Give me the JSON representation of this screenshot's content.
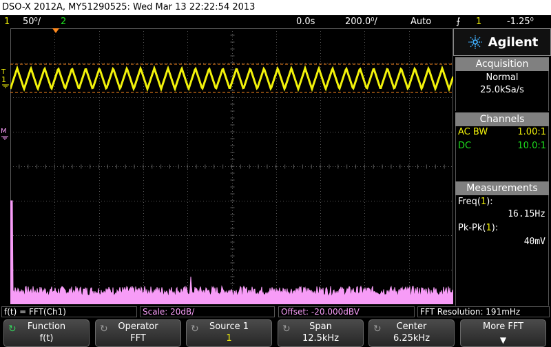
{
  "title_bar": {
    "text": "DSO-X 2012A, MY51290525: Wed Mar 13 22:22:54 2013"
  },
  "status_bar": {
    "ch1_num": "1",
    "ch1_scale": "50⁰/",
    "ch2_num": "2",
    "time_pos": "0.0s",
    "time_scale": "200.0⁰/",
    "trig_mode": "Auto",
    "trig_icon": "⨍",
    "trig_src": "1",
    "trig_level": "-1.25⁰"
  },
  "panel": {
    "brand": "Agilent",
    "acquisition": {
      "header": "Acquisition",
      "mode": "Normal",
      "rate": "25.0kSa/s"
    },
    "channels": {
      "header": "Channels",
      "rows": [
        {
          "coupling": "AC BW",
          "probe": "1.00:1",
          "color": "#f2f20a"
        },
        {
          "coupling": "DC",
          "probe": "10.0:1",
          "color": "#1ee01e"
        }
      ]
    },
    "measurements": {
      "header": "Measurements",
      "freq_label": "Freq(1):",
      "freq_value": "16.15Hz",
      "pkpk_label": "Pk-Pk(1):",
      "pkpk_value": "40mV"
    }
  },
  "info_line": {
    "math": "f(t) = FFT(Ch1)",
    "scale": "Scale: 20dB/",
    "offset": "Offset: -20.000dBV",
    "resolution": "FFT Resolution: 191mHz"
  },
  "softkeys": [
    {
      "top": "Function",
      "bottom": "f(t)",
      "rotary": "active"
    },
    {
      "top": "Operator",
      "bottom": "FFT",
      "rotary": "dim"
    },
    {
      "top": "Source 1",
      "bottom": "1",
      "rotary": "dim"
    },
    {
      "top": "Span",
      "bottom": "12.5kHz",
      "rotary": "dim"
    },
    {
      "top": "Center",
      "bottom": "6.25kHz",
      "rotary": "dim"
    },
    {
      "top": "More FFT",
      "bottom": "▼",
      "rotary": "none"
    }
  ],
  "markers": {
    "trigger_marker": "T",
    "ch1_marker": "1",
    "math_marker": "M"
  },
  "colors": {
    "ch1": "#f2f20a",
    "ch2": "#1ee01e",
    "math": "#f79cf7",
    "trigger_marker": "#ff8a1e",
    "grid": "#5a5a5a"
  }
}
